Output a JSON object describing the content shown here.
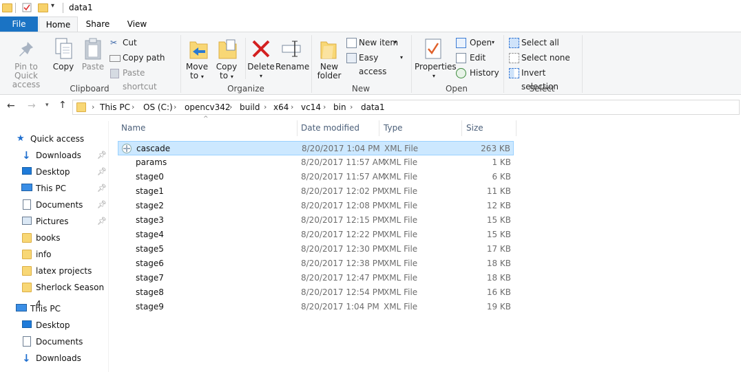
{
  "window": {
    "title": "data1"
  },
  "ribbon": {
    "tabs": {
      "file": "File",
      "home": "Home",
      "share": "Share",
      "view": "View"
    },
    "clipboard": {
      "label": "Clipboard",
      "pin_line1": "Pin to Quick",
      "pin_line2": "access",
      "copy": "Copy",
      "paste": "Paste",
      "cut": "Cut",
      "copy_path": "Copy path",
      "paste_shortcut": "Paste shortcut"
    },
    "organize": {
      "label": "Organize",
      "move_line1": "Move",
      "move_line2": "to",
      "copy_line1": "Copy",
      "copy_line2": "to",
      "delete": "Delete",
      "rename": "Rename"
    },
    "new": {
      "label": "New",
      "folder_line1": "New",
      "folder_line2": "folder",
      "new_item": "New item",
      "easy_access": "Easy access"
    },
    "open": {
      "label": "Open",
      "properties": "Properties",
      "open": "Open",
      "edit": "Edit",
      "history": "History"
    },
    "select": {
      "label": "Select",
      "select_all": "Select all",
      "select_none": "Select none",
      "invert": "Invert selection"
    }
  },
  "address": {
    "crumbs": [
      "This PC",
      "OS (C:)",
      "opencv342",
      "build",
      "x64",
      "vc14",
      "bin",
      "data1"
    ]
  },
  "nav": {
    "quick_access": "Quick access",
    "items": [
      {
        "label": "Downloads",
        "pinned": true
      },
      {
        "label": "Desktop",
        "pinned": true
      },
      {
        "label": "This PC",
        "pinned": true
      },
      {
        "label": "Documents",
        "pinned": true
      },
      {
        "label": "Pictures",
        "pinned": true
      },
      {
        "label": "books",
        "pinned": false
      },
      {
        "label": "info",
        "pinned": false
      },
      {
        "label": "latex projects",
        "pinned": false
      },
      {
        "label": "Sherlock Season 4",
        "pinned": false
      }
    ],
    "this_pc": "This PC",
    "pc_items": [
      "Desktop",
      "Documents",
      "Downloads"
    ]
  },
  "files": {
    "columns": {
      "name": "Name",
      "date": "Date modified",
      "type": "Type",
      "size": "Size"
    },
    "rows": [
      {
        "name": "cascade",
        "date": "8/20/2017 1:04 PM",
        "type": "XML File",
        "size": "263 KB"
      },
      {
        "name": "params",
        "date": "8/20/2017 11:57 AM",
        "type": "XML File",
        "size": "1 KB"
      },
      {
        "name": "stage0",
        "date": "8/20/2017 11:57 AM",
        "type": "XML File",
        "size": "6 KB"
      },
      {
        "name": "stage1",
        "date": "8/20/2017 12:02 PM",
        "type": "XML File",
        "size": "11 KB"
      },
      {
        "name": "stage2",
        "date": "8/20/2017 12:08 PM",
        "type": "XML File",
        "size": "12 KB"
      },
      {
        "name": "stage3",
        "date": "8/20/2017 12:15 PM",
        "type": "XML File",
        "size": "15 KB"
      },
      {
        "name": "stage4",
        "date": "8/20/2017 12:22 PM",
        "type": "XML File",
        "size": "15 KB"
      },
      {
        "name": "stage5",
        "date": "8/20/2017 12:30 PM",
        "type": "XML File",
        "size": "17 KB"
      },
      {
        "name": "stage6",
        "date": "8/20/2017 12:38 PM",
        "type": "XML File",
        "size": "18 KB"
      },
      {
        "name": "stage7",
        "date": "8/20/2017 12:47 PM",
        "type": "XML File",
        "size": "18 KB"
      },
      {
        "name": "stage8",
        "date": "8/20/2017 12:54 PM",
        "type": "XML File",
        "size": "16 KB"
      },
      {
        "name": "stage9",
        "date": "8/20/2017 1:04 PM",
        "type": "XML File",
        "size": "19 KB"
      }
    ]
  }
}
